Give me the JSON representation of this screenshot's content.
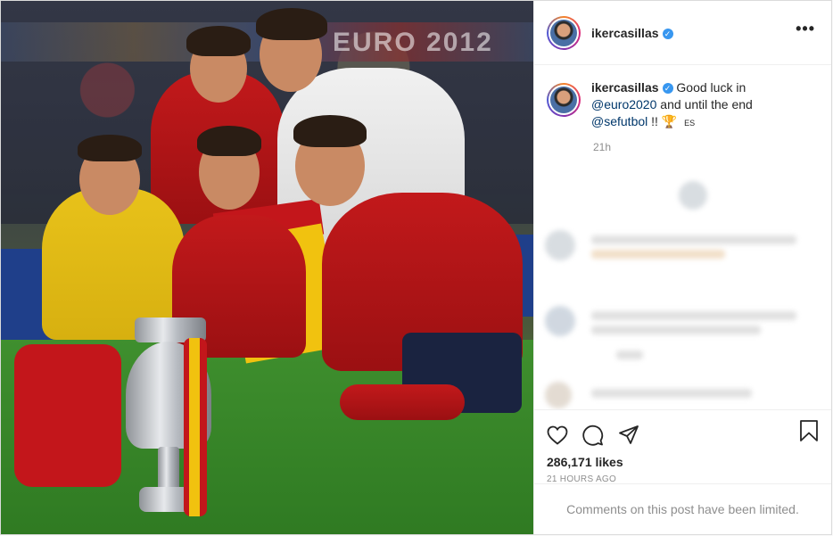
{
  "header": {
    "username": "ikercasillas",
    "more_label": "•••"
  },
  "photo": {
    "banner_text": "EURO 2012"
  },
  "caption": {
    "username": "ikercasillas",
    "text_before": "Good luck in",
    "mention_1": "@euro2020",
    "text_middle": "and until the end",
    "mention_2": "@sefutbol",
    "text_after": "!!",
    "emoji": "🏆",
    "translate_label": "ES",
    "time": "21h"
  },
  "actions": {
    "like_icon": "heart-icon",
    "comment_icon": "comment-icon",
    "share_icon": "share-icon",
    "save_icon": "bookmark-icon",
    "likes_text": "286,171 likes",
    "posted_ago": "21 HOURS AGO"
  },
  "footer": {
    "limited_text": "Comments on this post have been limited."
  },
  "colors": {
    "verified": "#3897f0",
    "link": "#00376b",
    "muted": "#8e8e8e"
  }
}
